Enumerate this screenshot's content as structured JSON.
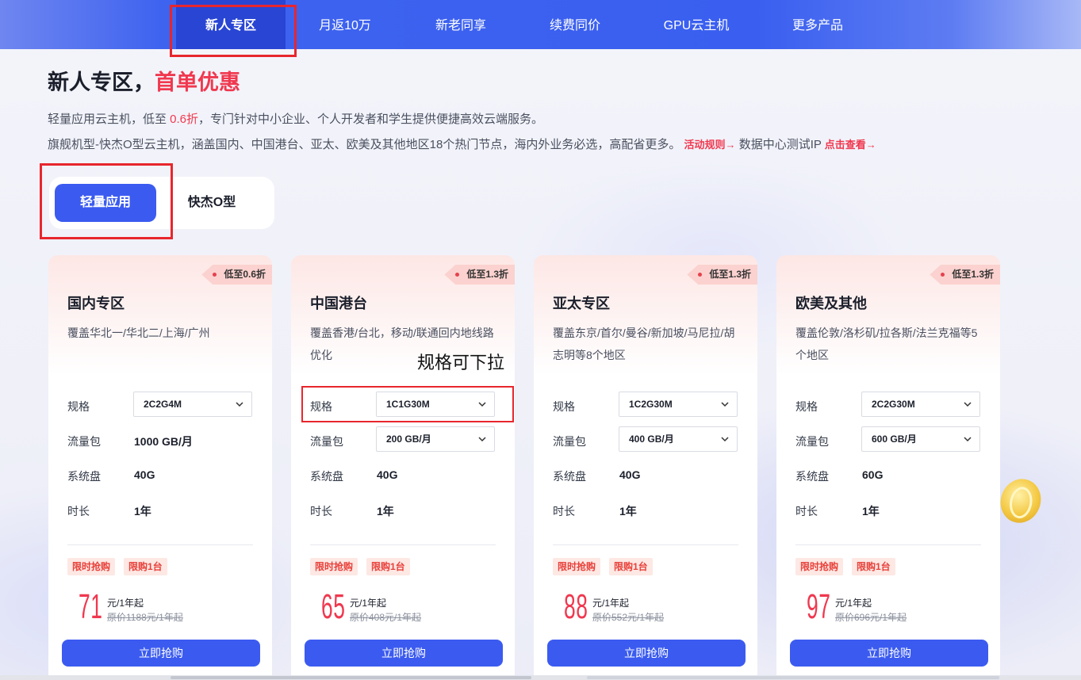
{
  "nav": {
    "items": [
      "新人专区",
      "月返10万",
      "新老同享",
      "续费同价",
      "GPU云主机",
      "更多产品"
    ],
    "active": "新人专区"
  },
  "headline": {
    "main": "新人专区，",
    "highlight": "首单优惠"
  },
  "desc1": {
    "pre": "轻量应用云主机，低至 ",
    "discount": "0.6折",
    "post": "，专门针对中小企业、个人开发者和学生提供便捷高效云端服务。"
  },
  "desc2": {
    "text": "旗舰机型-快杰O型云主机，涵盖国内、中国港台、亚太、欧美及其他地区18个热门节点，海内外业务必选，高配省更多。",
    "rules_link": "活动规则→",
    "ip_text": "数据中心测试IP",
    "view_link": "点击查看→"
  },
  "product_tabs": {
    "active": "轻量应用",
    "other": "快杰O型"
  },
  "labels": {
    "spec": "规格",
    "traffic": "流量包",
    "disk": "系统盘",
    "duration": "时长",
    "tag1": "限时抢购",
    "tag2": "限购1台",
    "buy": "立即抢购",
    "unit": "元/1年起"
  },
  "annotation": "规格可下拉",
  "cards": [
    {
      "badge": "低至0.6折",
      "title": "国内专区",
      "desc": "覆盖华北一/华北二/上海/广州",
      "spec": "2C2G4M",
      "traffic": "1000 GB/月",
      "disk": "40G",
      "duration": "1年",
      "price": "71",
      "orig": "原价1188元/1年起"
    },
    {
      "badge": "低至1.3折",
      "title": "中国港台",
      "desc": "覆盖香港/台北，移动/联通回内地线路优化",
      "spec": "1C1G30M",
      "traffic": "200 GB/月",
      "disk": "40G",
      "duration": "1年",
      "price": "65",
      "orig": "原价408元/1年起"
    },
    {
      "badge": "低至1.3折",
      "title": "亚太专区",
      "desc": "覆盖东京/首尔/曼谷/新加坡/马尼拉/胡志明等8个地区",
      "spec": "1C2G30M",
      "traffic": "400 GB/月",
      "disk": "40G",
      "duration": "1年",
      "price": "88",
      "orig": "原价552元/1年起"
    },
    {
      "badge": "低至1.3折",
      "title": "欧美及其他",
      "desc": "覆盖伦敦/洛杉矶/拉各斯/法兰克福等5个地区",
      "spec": "2C2G30M",
      "traffic": "600 GB/月",
      "disk": "60G",
      "duration": "1年",
      "price": "97",
      "orig": "原价696元/1年起"
    }
  ],
  "colors": {
    "brand": "#3b5bf0",
    "hot": "#f0384f",
    "highlight_box": "#e8262d"
  }
}
